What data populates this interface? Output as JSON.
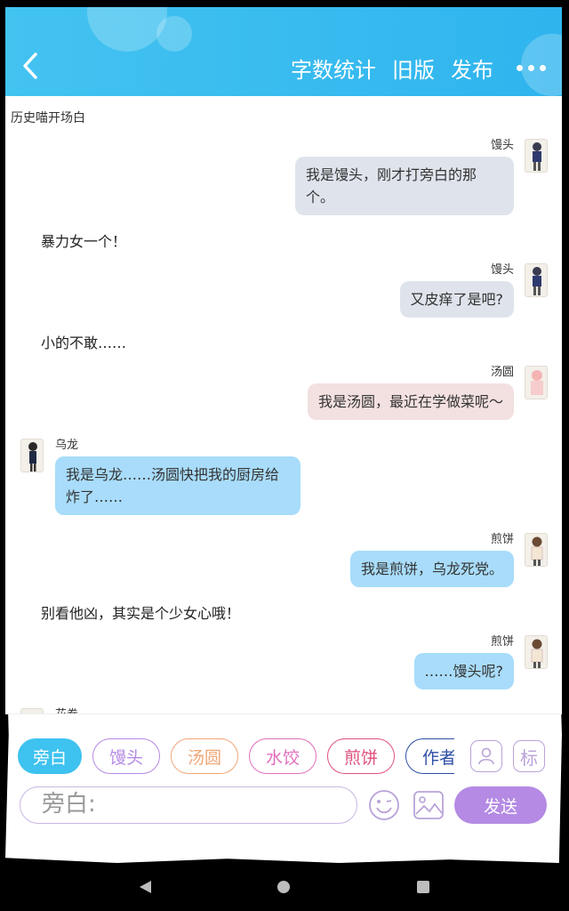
{
  "header": {
    "actions": [
      "字数统计",
      "旧版",
      "发布"
    ],
    "accent": "#3ebcf0"
  },
  "chat": {
    "history_label": "历史喵开场白",
    "messages": [
      {
        "side": "right",
        "name": "馒头",
        "text": "我是馒头，刚才打旁白的那个。",
        "style": "gray"
      },
      {
        "side": "narration",
        "text": "暴力女一个！"
      },
      {
        "side": "right",
        "name": "馒头",
        "text": "又皮痒了是吧?",
        "style": "gray"
      },
      {
        "side": "narration",
        "text": "小的不敢……"
      },
      {
        "side": "right",
        "name": "汤圆",
        "text": "我是汤圆，最近在学做菜呢～",
        "style": "pink"
      },
      {
        "side": "left",
        "name": "乌龙",
        "text": "我是乌龙……汤圆快把我的厨房给炸了……",
        "style": "blue"
      },
      {
        "side": "right",
        "name": "煎饼",
        "text": "我是煎饼，乌龙死党。",
        "style": "blue"
      },
      {
        "side": "narration",
        "text": "别看他凶，其实是个少女心哦！"
      },
      {
        "side": "right",
        "name": "煎饼",
        "text": "……馒头呢?",
        "style": "blue"
      },
      {
        "side": "left",
        "name": "花卷",
        "text": "",
        "style": "blue"
      }
    ]
  },
  "roles": [
    {
      "label": "旁白",
      "color": "#3ec2ef",
      "active": true
    },
    {
      "label": "馒头",
      "color": "#b48ae4"
    },
    {
      "label": "汤圆",
      "color": "#f0a676"
    },
    {
      "label": "水饺",
      "color": "#e06dbd"
    },
    {
      "label": "煎饼",
      "color": "#e04f7c"
    },
    {
      "label": "作者",
      "color": "#2e4fa8"
    }
  ],
  "tool_icons": {
    "role_icon": "person-card-icon",
    "tag_label": "标"
  },
  "input": {
    "placeholder": "旁白:",
    "send_label": "发送"
  }
}
